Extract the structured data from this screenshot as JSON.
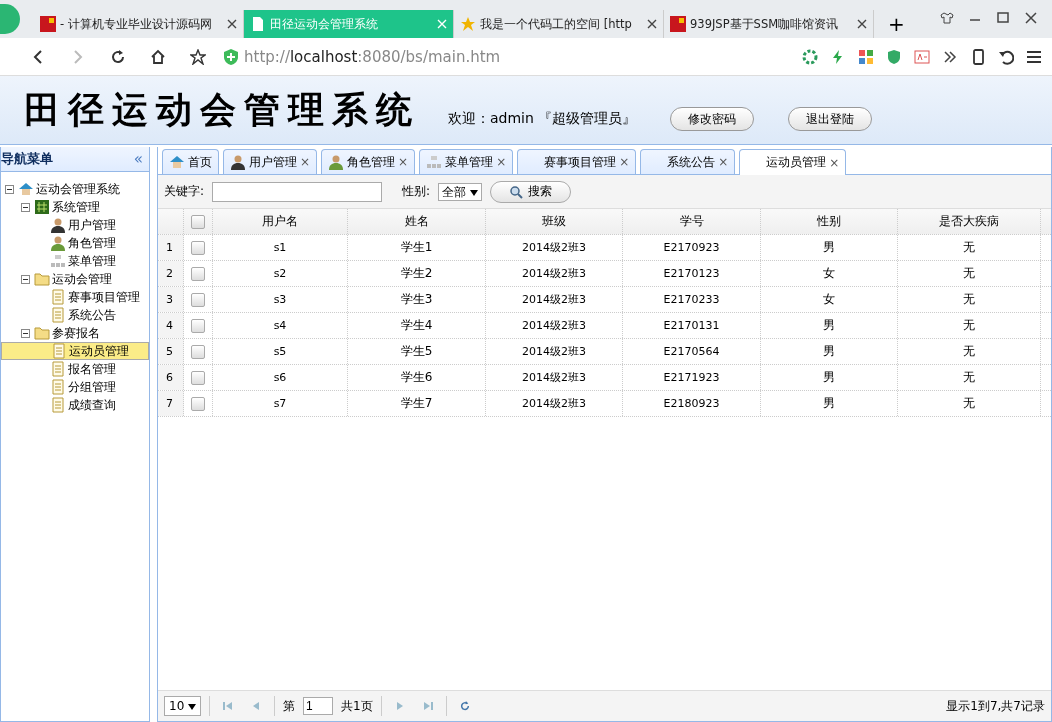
{
  "browser": {
    "tabs": [
      {
        "title": "- 计算机专业毕业设计源码网",
        "selected": false,
        "kind": "red"
      },
      {
        "title": "田径运动会管理系统",
        "selected": true,
        "kind": "page"
      },
      {
        "title": "我是一个代码工的空间 [http",
        "selected": false,
        "kind": "star"
      },
      {
        "title": "939JSP基于SSM咖啡馆资讯",
        "selected": false,
        "kind": "red"
      }
    ],
    "new_tab": "+",
    "address": {
      "scheme": "http://",
      "host": "localhost",
      "rest": ":8080/bs/main.htm"
    }
  },
  "banner": {
    "title": "田径运动会管理系统",
    "welcome": "欢迎：admin 『超级管理员』",
    "buttons": [
      "修改密码",
      "退出登陆"
    ]
  },
  "sidebar": {
    "title": "导航菜单",
    "collapse": "«",
    "tree": [
      {
        "label": "运动会管理系统",
        "kind": "home",
        "expanded": true,
        "selected": false,
        "children": [
          {
            "label": "系统管理",
            "kind": "module",
            "expanded": true,
            "selected": false,
            "children": [
              {
                "label": "用户管理",
                "kind": "user",
                "selected": false
              },
              {
                "label": "角色管理",
                "kind": "role",
                "selected": false
              },
              {
                "label": "菜单管理",
                "kind": "menu",
                "selected": false
              }
            ]
          },
          {
            "label": "运动会管理",
            "kind": "folder",
            "expanded": true,
            "selected": false,
            "children": [
              {
                "label": "赛事项目管理",
                "kind": "page",
                "selected": false
              },
              {
                "label": "系统公告",
                "kind": "page",
                "selected": false
              }
            ]
          },
          {
            "label": "参赛报名",
            "kind": "folder",
            "expanded": true,
            "selected": false,
            "children": [
              {
                "label": "运动员管理",
                "kind": "page",
                "selected": true
              },
              {
                "label": "报名管理",
                "kind": "page",
                "selected": false
              },
              {
                "label": "分组管理",
                "kind": "page",
                "selected": false
              },
              {
                "label": "成绩查询",
                "kind": "page",
                "selected": false
              }
            ]
          }
        ]
      }
    ]
  },
  "tabs": [
    {
      "label": "首页",
      "kind": "home",
      "closable": false,
      "selected": false
    },
    {
      "label": "用户管理",
      "kind": "user",
      "closable": true,
      "selected": false
    },
    {
      "label": "角色管理",
      "kind": "role",
      "closable": true,
      "selected": false
    },
    {
      "label": "菜单管理",
      "kind": "menu",
      "closable": true,
      "selected": false
    },
    {
      "label": "赛事项目管理",
      "kind": "none",
      "closable": true,
      "selected": false
    },
    {
      "label": "系统公告",
      "kind": "none",
      "closable": true,
      "selected": false
    },
    {
      "label": "运动员管理",
      "kind": "none",
      "closable": true,
      "selected": true
    }
  ],
  "close": "×",
  "search": {
    "keyword_label": "关键字:",
    "gender_label": "性别:",
    "gender_value": "全部",
    "button": "搜索"
  },
  "table": {
    "select_all_checked": false,
    "columns": [
      "用户名",
      "姓名",
      "班级",
      "学号",
      "性别",
      "是否大疾病"
    ],
    "rows": [
      {
        "n": "1",
        "checked": false,
        "cells": [
          "s1",
          "学生1",
          "2014级2班3",
          "E2170923",
          "男",
          "无"
        ]
      },
      {
        "n": "2",
        "checked": false,
        "cells": [
          "s2",
          "学生2",
          "2014级2班3",
          "E2170123",
          "女",
          "无"
        ]
      },
      {
        "n": "3",
        "checked": false,
        "cells": [
          "s3",
          "学生3",
          "2014级2班3",
          "E2170233",
          "女",
          "无"
        ]
      },
      {
        "n": "4",
        "checked": false,
        "cells": [
          "s4",
          "学生4",
          "2014级2班3",
          "E2170131",
          "男",
          "无"
        ]
      },
      {
        "n": "5",
        "checked": false,
        "cells": [
          "s5",
          "学生5",
          "2014级2班3",
          "E2170564",
          "男",
          "无"
        ]
      },
      {
        "n": "6",
        "checked": false,
        "cells": [
          "s6",
          "学生6",
          "2014级2班3",
          "E2171923",
          "男",
          "无"
        ]
      },
      {
        "n": "7",
        "checked": false,
        "cells": [
          "s7",
          "学生7",
          "2014级2班3",
          "E2180923",
          "男",
          "无"
        ]
      }
    ]
  },
  "pager": {
    "page_size": "10",
    "page_prefix": "第",
    "page": "1",
    "page_suffix": "共1页",
    "summary": "显示1到7,共7记录"
  }
}
